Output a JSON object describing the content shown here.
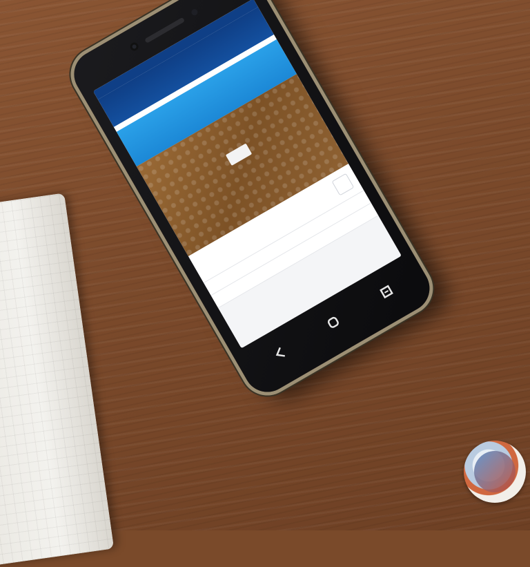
{
  "status_bar": {
    "left": "",
    "right": ""
  },
  "header": {
    "line1": "",
    "line2": "",
    "big": ""
  },
  "info_strip": {
    "left": "",
    "right": ""
  },
  "blue_band": {
    "number": "",
    "sub": ""
  },
  "banner": {
    "headline": "",
    "caption": ""
  },
  "list": [
    {
      "text": "",
      "style": "blue"
    },
    {
      "text": "",
      "style": "red"
    },
    {
      "text": "",
      "style": "dark"
    }
  ],
  "icons": {
    "nav_back": "back-icon",
    "nav_home": "home-icon",
    "nav_recent": "recent-apps-icon"
  },
  "colors": {
    "header_blue": "#0f3f86",
    "band_blue": "#2aa0e8",
    "banner_brown": "#8e6132",
    "accent_red": "#d22a2a",
    "table_wood": "#7b4a2b"
  }
}
